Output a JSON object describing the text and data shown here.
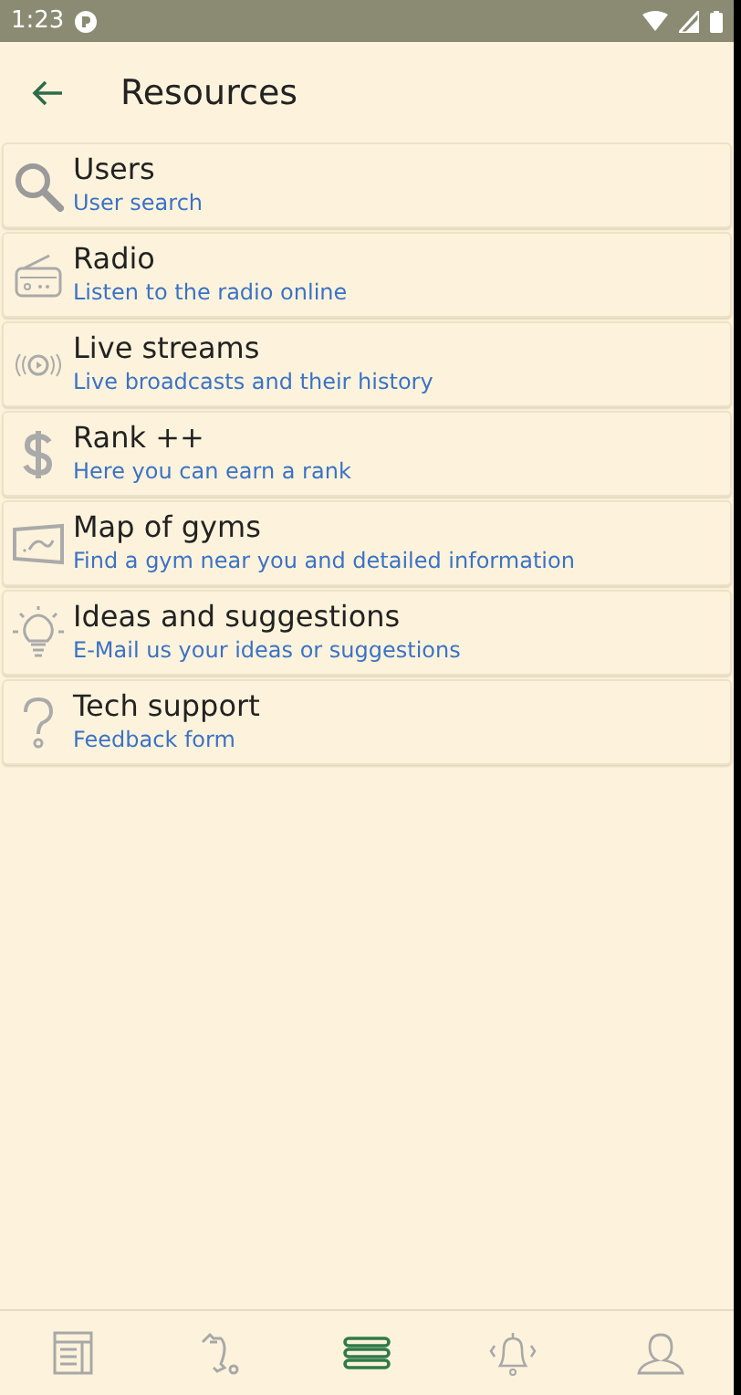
{
  "status_bar": {
    "time": "1:23"
  },
  "app_bar": {
    "title": "Resources"
  },
  "items": [
    {
      "kind": "search",
      "title": "Users",
      "subtitle": "User search"
    },
    {
      "kind": "radio",
      "title": "Radio",
      "subtitle": "Listen to the radio online"
    },
    {
      "kind": "live",
      "title": "Live streams",
      "subtitle": "Live broadcasts and their history"
    },
    {
      "kind": "dollar",
      "title": "Rank ++",
      "subtitle": "Here you can earn a rank"
    },
    {
      "kind": "map",
      "title": "Map of gyms",
      "subtitle": "Find a gym near you and detailed information"
    },
    {
      "kind": "bulb",
      "title": "Ideas and suggestions",
      "subtitle": "E-Mail us your ideas or suggestions"
    },
    {
      "kind": "question",
      "title": "Tech support",
      "subtitle": "Feedback form"
    }
  ],
  "bottom_nav": [
    {
      "kind": "news",
      "selected": false
    },
    {
      "kind": "tool",
      "selected": false
    },
    {
      "kind": "menu",
      "selected": true
    },
    {
      "kind": "bell",
      "selected": false
    },
    {
      "kind": "person",
      "selected": false
    }
  ]
}
